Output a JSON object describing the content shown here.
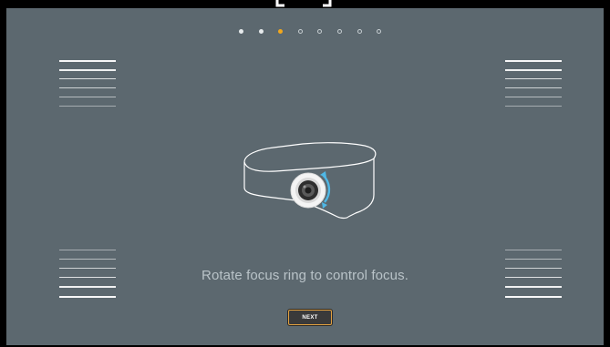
{
  "pager": {
    "dots": [
      {
        "state": "filled"
      },
      {
        "state": "filled"
      },
      {
        "state": "active"
      },
      {
        "state": "hollow"
      },
      {
        "state": "hollow"
      },
      {
        "state": "hollow"
      },
      {
        "state": "hollow"
      },
      {
        "state": "hollow"
      }
    ],
    "current_step": 3,
    "total_steps": 8
  },
  "instruction": {
    "text": "Rotate focus ring to control focus.",
    "illustration_icon": "projector-focus-ring-icon"
  },
  "actions": {
    "next_label": "NEXT"
  },
  "colors": {
    "background": "#5c686f",
    "accent": "#f2a71c",
    "ring_highlight": "#4fb8e6",
    "text": "#b9c3c8"
  }
}
